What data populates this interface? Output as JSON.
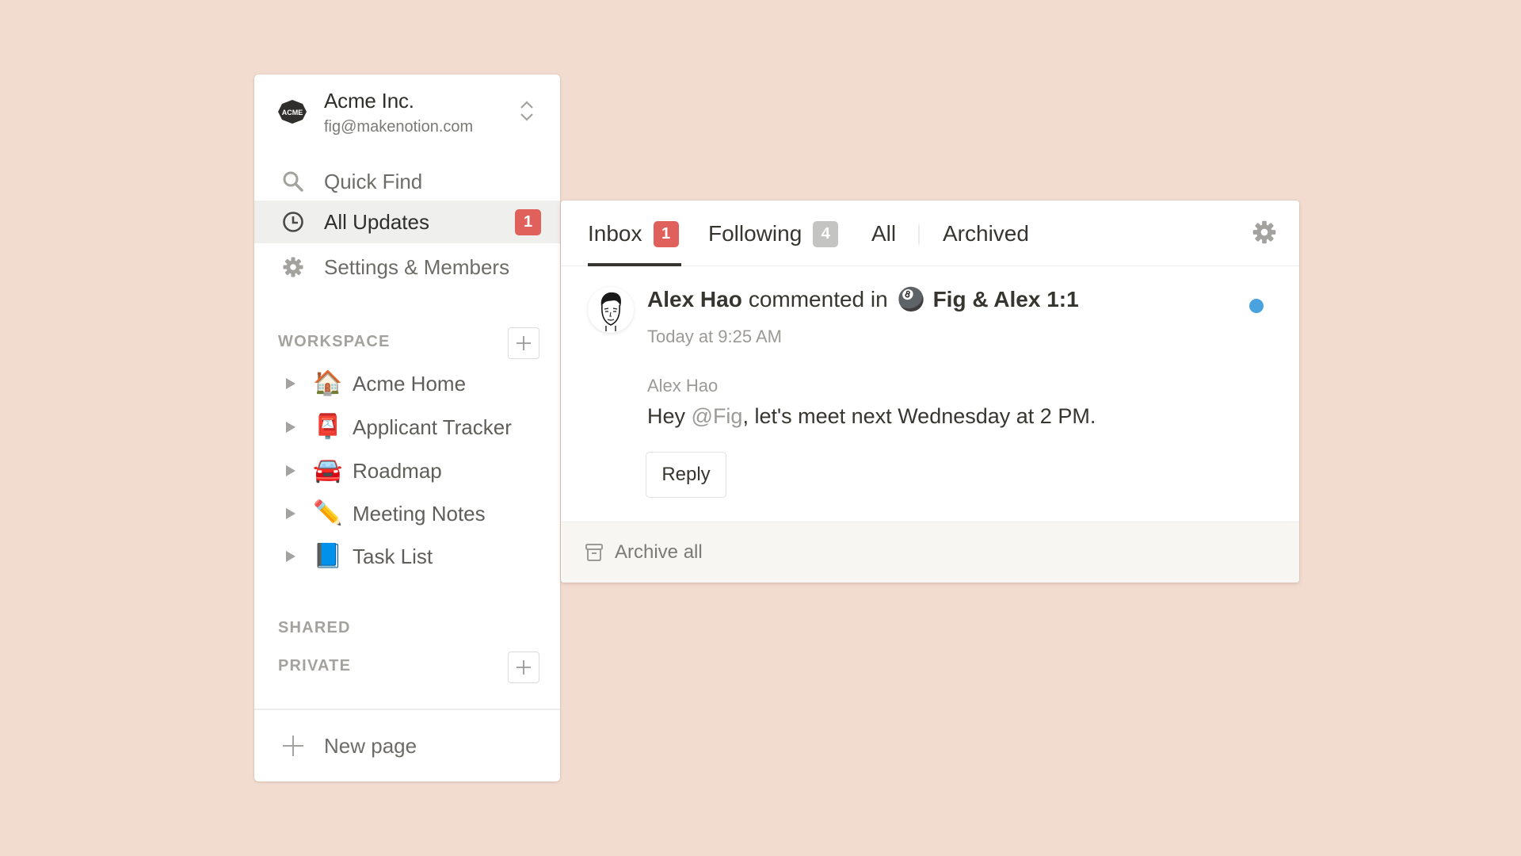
{
  "workspace": {
    "name": "Acme Inc.",
    "email": "fig@makenotion.com",
    "logo_text": "ACME"
  },
  "nav": {
    "quick_find": "Quick Find",
    "all_updates": "All Updates",
    "all_updates_badge": "1",
    "settings": "Settings & Members"
  },
  "sections": {
    "workspace": "WORKSPACE",
    "shared": "SHARED",
    "private": "PRIVATE"
  },
  "pages": [
    {
      "emoji": "🏠",
      "label": "Acme Home"
    },
    {
      "emoji": "📮",
      "label": "Applicant Tracker"
    },
    {
      "emoji": "🚘",
      "label": "Roadmap"
    },
    {
      "emoji": "✏️",
      "label": "Meeting Notes"
    },
    {
      "emoji": "📘",
      "label": "Task List"
    }
  ],
  "new_page": "New page",
  "updates": {
    "tabs": [
      {
        "label": "Inbox",
        "badge": "1",
        "badge_color": "#e0605b",
        "active": true
      },
      {
        "label": "Following",
        "badge": "4",
        "badge_color": "#c4c4c2",
        "active": false
      },
      {
        "label": "All",
        "active": false
      },
      {
        "label": "Archived",
        "active": false
      }
    ],
    "notification": {
      "author": "Alex Hao",
      "action": "commented in",
      "page_emoji": "🎱",
      "page_title": "Fig & Alex 1:1",
      "time": "Today at 9:25 AM",
      "comment_author": "Alex Hao",
      "comment_prefix": "Hey ",
      "comment_mention": "@Fig",
      "comment_suffix": ", let's meet next Wednesday at 2 PM.",
      "unread": true,
      "unread_color": "#4aa3df"
    },
    "reply_label": "Reply",
    "archive_all": "Archive all"
  }
}
